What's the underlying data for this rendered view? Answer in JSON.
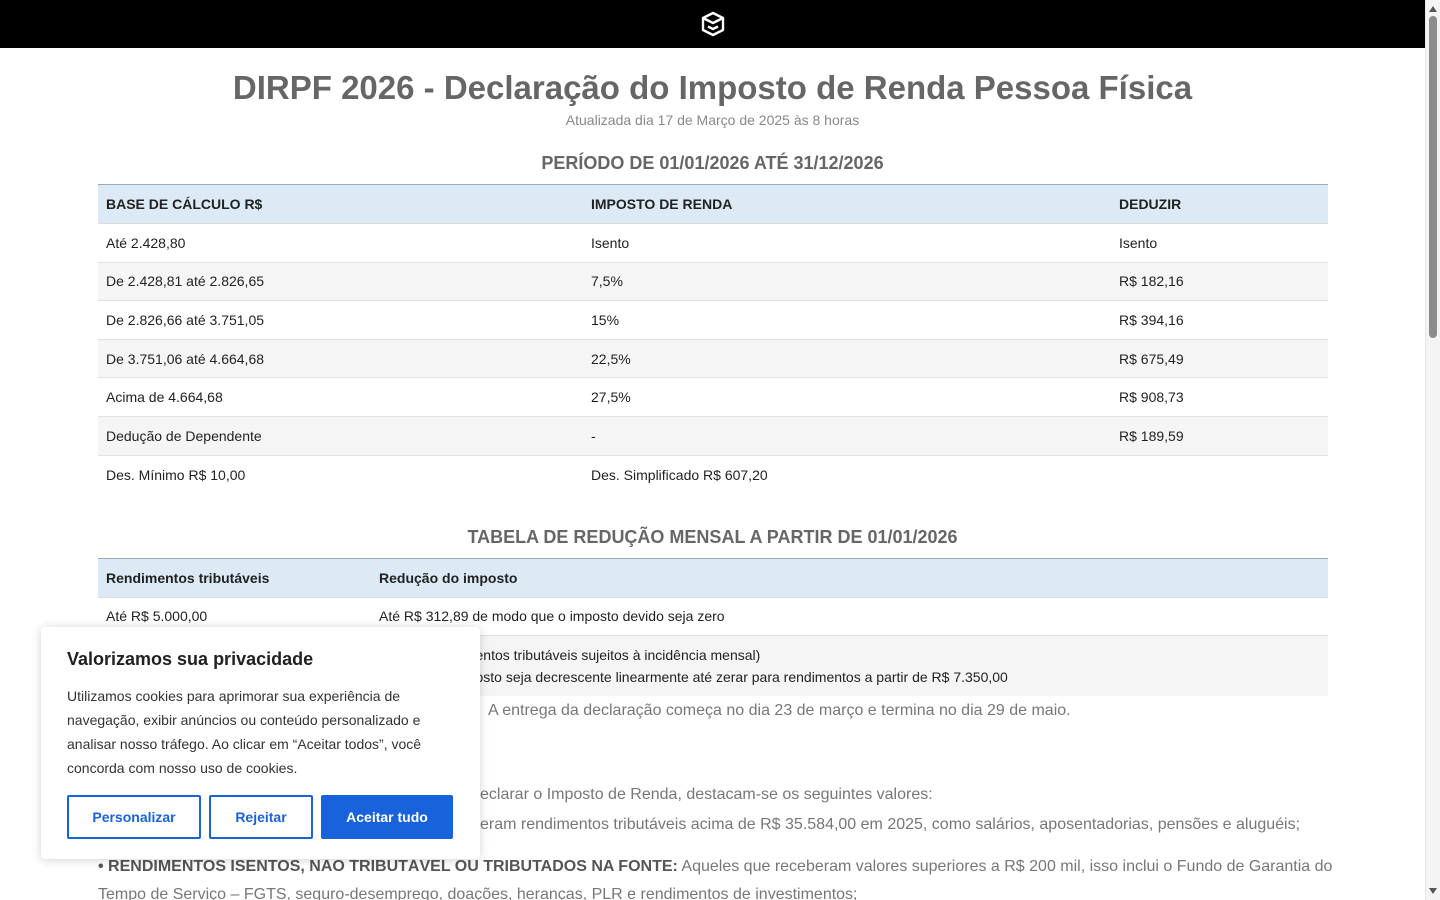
{
  "header": {
    "logo_icon": "cube-logo-icon",
    "background": "#000000"
  },
  "page": {
    "title": "DIRPF 2026 - Declaração do Imposto de Renda Pessoa Física",
    "updated": "Atualizada dia 17 de Março de 2025 às 8 horas"
  },
  "table1": {
    "title": "PERÍODO DE 01/01/2026 ATÉ 31/12/2026",
    "headers": [
      "BASE DE CÁLCULO R$",
      "IMPOSTO DE RENDA",
      "DEDUZIR"
    ],
    "rows": [
      [
        "Até 2.428,80",
        "Isento",
        "Isento"
      ],
      [
        "De 2.428,81 até 2.826,65",
        "7,5%",
        "R$ 182,16"
      ],
      [
        "De 2.826,66 até 3.751,05",
        "15%",
        "R$ 394,16"
      ],
      [
        "De 3.751,06 até 4.664,68",
        "22,5%",
        "R$ 675,49"
      ],
      [
        "Acima de 4.664,68",
        "27,5%",
        "R$ 908,73"
      ],
      [
        "Dedução de Dependente",
        "-",
        "R$ 189,59"
      ],
      [
        "Des. Mínimo R$ 10,00",
        "Des. Simplificado R$ 607,20",
        ""
      ]
    ]
  },
  "table2": {
    "title": "TABELA DE REDUÇÃO MENSAL A PARTIR DE 01/01/2026",
    "headers": [
      "Rendimentos tributáveis",
      "Redução do imposto"
    ],
    "rows": [
      {
        "col1": "Até R$ 5.000,00",
        "line1": "Até R$ 312,89 de modo que o imposto devido seja zero",
        "line2": ""
      },
      {
        "col1": "",
        "line1": "33145 x rendimentos tributáveis sujeitos à incidência mensal)",
        "line2": "redução do imposto seja decrescente linearmente até zerar para rendimentos a partir de R$ 7.350,00"
      }
    ]
  },
  "paragraphs": {
    "delivery": "A entrega da declaração começa no dia 23 de março e termina no dia 29 de maio.",
    "who_intro": "eclarar o Imposto de Renda, destacam-se os seguintes valores:",
    "taxable_income": "eram rendimentos tributáveis acima de R$ 35.584,00 em 2025, como salários, aposentadorias, pensões e aluguéis;",
    "exempt_label": "• RENDIMENTOS ISENTOS, NÃO TRIBUTÁVEL OU TRIBUTADOS NA FONTE:",
    "exempt_text": " Aqueles que receberam valores superiores a R$ 200 mil, isso inclui o Fundo de Garantia do",
    "exempt_cont": "Tempo de Serviço – FGTS, seguro-desemprego, doações, heranças, PLR e rendimentos de investimentos;"
  },
  "cookie": {
    "title": "Valorizamos sua privacidade",
    "text": "Utilizamos cookies para aprimorar sua experiência de navegação, exibir anúncios ou conteúdo personalizado e analisar nosso tráfego. Ao clicar em “Aceitar todos”, você concorda com nosso uso de cookies.",
    "customize": "Personalizar",
    "reject": "Rejeitar",
    "accept": "Aceitar tudo",
    "accent": "#1863dc"
  }
}
